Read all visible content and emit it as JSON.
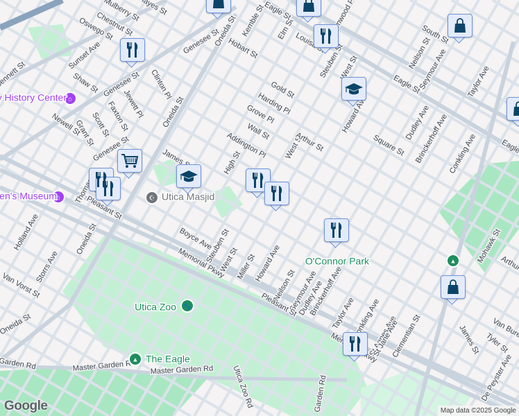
{
  "street_labels": [
    "Mulberry St",
    "Chestnut St",
    "Oswego St",
    "Hayes St",
    "Sunset Ave",
    "Bennett St",
    "Shaw St",
    "Genesee St",
    "Genesee St",
    "Genesee St",
    "Clinton Pl",
    "Jewett Pl",
    "Faxton St",
    "Scott St",
    "Grant St",
    "Newell St",
    "Oneida St",
    "Oneida St",
    "Oneida St",
    "Oneida St",
    "Hobart St",
    "Kemble St",
    "James St",
    "High St",
    "Addington Pl",
    "Wall St",
    "Grove Pl",
    "Harding Pl",
    "Gold St",
    "Elm St",
    "Louisa St",
    "Steuben St",
    "West St",
    "West St",
    "West St",
    "Arthur St",
    "Howard Ave",
    "Howard Ave",
    "Eagle St",
    "Eagle St",
    "Eagle St",
    "South St",
    "Neilson St",
    "Neilson St",
    "Seymour Ave",
    "Seymour Ave",
    "Dudley Ave",
    "Dudley Ave",
    "Brinckerhoff Ave",
    "Brinckerhoff Ave",
    "Square St",
    "Conkling Ave",
    "Conkling Ave",
    "Taylor Ave",
    "Taylor Ave",
    "Boyce Ave",
    "Steuben St",
    "Miller St",
    "Holland Ave",
    "Storrs Ave",
    "Van Vorst St",
    "Master Garden Rd",
    "Master Garden Rd",
    "Garden Rd",
    "Utica Zoo Rd",
    "Pleasant St",
    "Pleasant St",
    "Memorial Pkwy",
    "Memorial Pkwy",
    "St Agnes Ave",
    "St Jane Ave",
    "Clementian St",
    "Mohawk St",
    "James St",
    "Tyler St",
    "Van Buren",
    "De Peyster Ave",
    "Arthur",
    "Garden Rd",
    "Thomas St",
    "Elmwood Pl"
  ],
  "pois": [
    {
      "name": "Oneida County History Center",
      "category": "museum",
      "color": "#a142f4"
    },
    {
      "name": "Children's Museum",
      "category": "museum",
      "color": "#a142f4"
    },
    {
      "name": "Utica Masjid",
      "category": "worship",
      "color": "#70757a"
    },
    {
      "name": "Utica Zoo",
      "category": "zoo",
      "color": "#1e8e5e"
    },
    {
      "name": "The Eagle",
      "category": "park",
      "color": "#1e8e5e"
    },
    {
      "name": "O'Connor Park",
      "category": "park",
      "color": "#1e8e5e"
    }
  ],
  "markers": [
    {
      "type": "shopping"
    },
    {
      "type": "shopping"
    },
    {
      "type": "shopping"
    },
    {
      "type": "shopping"
    },
    {
      "type": "shopping"
    },
    {
      "type": "restaurant"
    },
    {
      "type": "restaurant"
    },
    {
      "type": "restaurant"
    },
    {
      "type": "restaurant"
    },
    {
      "type": "restaurant"
    },
    {
      "type": "restaurant"
    },
    {
      "type": "restaurant"
    },
    {
      "type": "restaurant"
    },
    {
      "type": "grocery"
    },
    {
      "type": "school"
    },
    {
      "type": "school"
    }
  ],
  "colors": {
    "marker_icon": "#0b4468",
    "marker_bg": "#e3ebfb",
    "park": "#c3f0d4",
    "road": "#dbe2ea"
  },
  "google_logo": "Google",
  "attribution": "Map data ©2025 Google"
}
